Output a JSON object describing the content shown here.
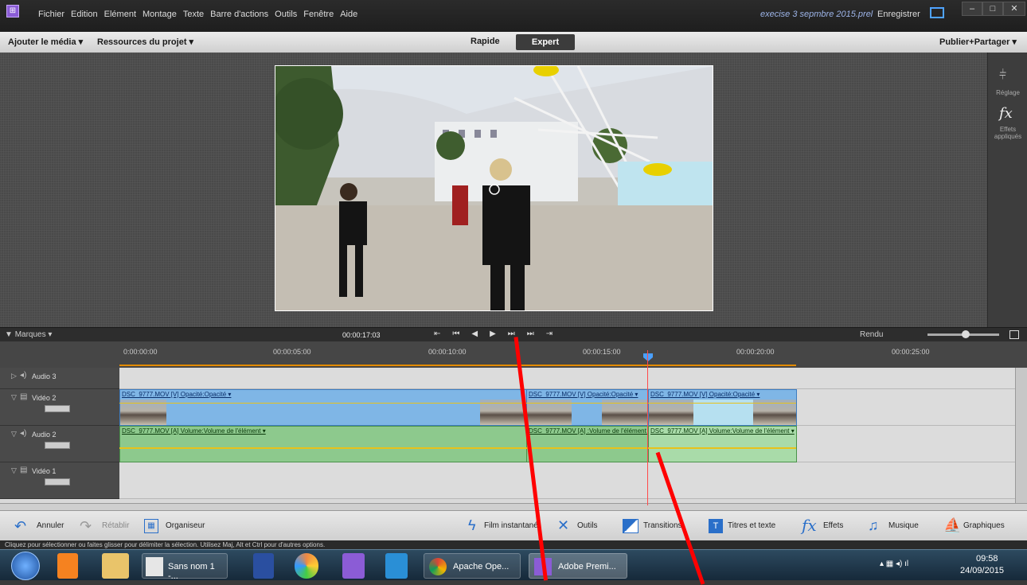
{
  "menu": {
    "items": [
      "Fichier",
      "Edition",
      "Elément",
      "Montage",
      "Texte",
      "Barre d'actions",
      "Outils",
      "Fenêtre",
      "Aide"
    ],
    "project": "execise 3 sepmbre 2015.prel",
    "save": "Enregistrer"
  },
  "toolbar": {
    "add_media": "Ajouter le média ▾",
    "resources": "Ressources du projet ▾",
    "quick": "Rapide",
    "expert": "Expert",
    "publish": "Publier+Partager ▾"
  },
  "right_panel": {
    "adjust": "Réglage",
    "effects": "Effets appliqués"
  },
  "transport": {
    "marks": "Marques",
    "timecode": "00:00:17:03",
    "render": "Rendu"
  },
  "ruler": {
    "ticks": [
      "0:00:00:00",
      "00:00:05:00",
      "00:00:10:00",
      "00:00:15:00",
      "00:00:20:00",
      "00:00:25:00"
    ]
  },
  "tracks": {
    "audio3": "Audio 3",
    "video2": "Vidéo 2",
    "audio2": "Audio 2",
    "video1": "Vidéo 1"
  },
  "clips": {
    "v1": "DSC_9777.MOV [V]  Opacité:Opacité ▾",
    "v2": "DSC_9777.MOV [V]  Opacité:Opacité ▾",
    "v3": "DSC_9777.MOV [V]  Opacité:Opacité ▾",
    "a1": "DSC_9777.MOV [A]  Volume:Volume de l'élément ▾",
    "a2": "DSC_9777.MOV [A]  :Volume de l'élément ▾",
    "a3": "DSC_9777.MOV [A]  Volume:Volume de l'élément ▾"
  },
  "bottom": {
    "undo": "Annuler",
    "redo": "Rétablir",
    "organizer": "Organiseur",
    "instant": "Film instantané",
    "tools": "Outils",
    "transitions": "Transitions",
    "titles": "Titres et texte",
    "effects": "Effets",
    "music": "Musique",
    "graphics": "Graphiques"
  },
  "status": "Cliquez pour sélectionner ou faites glisser pour délimiter la sélection. Utilisez Maj, Alt et Ctrl pour d'autres options.",
  "taskbar": {
    "app1": "Sans nom 1 -...",
    "app2": "Apache Ope...",
    "app3": "Adobe Premi...",
    "time": "09:58",
    "date": "24/09/2015"
  }
}
